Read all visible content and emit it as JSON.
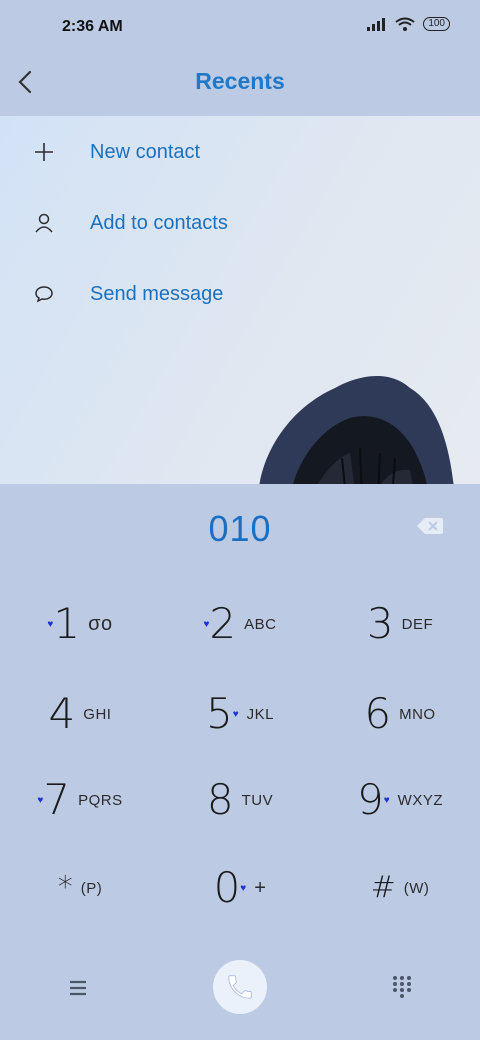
{
  "status": {
    "time": "2:36 AM",
    "battery": "100"
  },
  "header": {
    "title": "Recents"
  },
  "actions": [
    {
      "label": "New contact"
    },
    {
      "label": "Add to contacts"
    },
    {
      "label": "Send message"
    }
  ],
  "dialer": {
    "number": "010",
    "keys": [
      {
        "digit": "1",
        "letters": "σo"
      },
      {
        "digit": "2",
        "letters": "ABC"
      },
      {
        "digit": "3",
        "letters": "DEF"
      },
      {
        "digit": "4",
        "letters": "GHI"
      },
      {
        "digit": "5",
        "letters": "JKL"
      },
      {
        "digit": "6",
        "letters": "MNO"
      },
      {
        "digit": "7",
        "letters": "PQRS"
      },
      {
        "digit": "8",
        "letters": "TUV"
      },
      {
        "digit": "9",
        "letters": "WXYZ"
      },
      {
        "digit": "*",
        "letters": "(P)"
      },
      {
        "digit": "0",
        "letters": "+"
      },
      {
        "digit": "#",
        "letters": "(W)"
      }
    ]
  },
  "colors": {
    "accent": "#1f78c8",
    "background": "#bccbe3",
    "heart": "#1d32d8"
  },
  "icons": {
    "back": "back-arrow-icon",
    "new_contact": "plus-icon",
    "add_contact": "person-icon",
    "message": "chat-bubble-icon",
    "backspace": "backspace-icon",
    "menu": "hamburger-menu-icon",
    "call": "phone-icon",
    "dialpad": "dialpad-grid-icon"
  }
}
